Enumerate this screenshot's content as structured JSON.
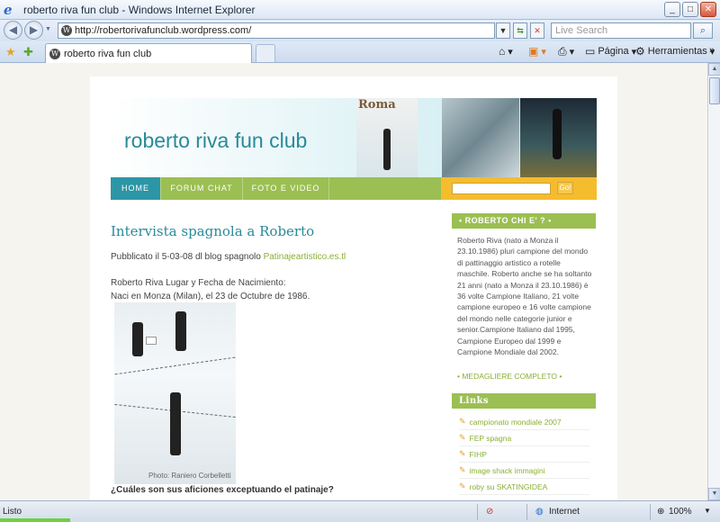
{
  "window": {
    "title": "roberto riva fun club - Windows Internet Explorer",
    "controls": [
      "_",
      "□",
      "✕"
    ]
  },
  "addressbar": {
    "url": "http://robertorivafunclub.wordpress.com/",
    "search_placeholder": "Live Search"
  },
  "tabs": [
    {
      "label": "roberto riva fun club"
    }
  ],
  "commandbar": {
    "page_label": "Página",
    "tools_label": "Herramientas"
  },
  "blog": {
    "title": "roberto riva fun club",
    "header_photo_text": "Roma",
    "nav": [
      "HOME",
      "FORUM CHAT",
      "FOTO E VIDEO"
    ],
    "search_button": "Go!"
  },
  "post": {
    "title": "Intervista spagnola a Roberto",
    "published_prefix": "Pubblicato il 5-03-08 dl blog spagnolo ",
    "published_link": "Patinajeartistico.es.tl",
    "line1": "Roberto Riva Lugar y Fecha de Nacimiento:",
    "line2": "Naci en Monza (Milan), el 23 de Octubre de 1986.",
    "photo_credit": "Photo: Raniero Corbelletti",
    "subheading": "¿Cuáles son sus aficiones exceptuando el patinaje?"
  },
  "sidebar": {
    "about_title": "• ROBERTO CHI E' ? •",
    "about_text": "Roberto Riva (nato a Monza il 23.10.1986) pluri campione del mondo di pattinaggio artistico a rotelle maschile. Roberto anche se ha soltanto 21 anni (nato a Monza il 23.10.1986) è 36 volte Campione Italiano, 21 volte campione europeo e 16 volte campione del mondo nelle categorie junior e senior.Campione Italiano dal 1995, Campione Europeo dal 1999 e Campione Mondiale dal 2002.",
    "about_more": "• MEDAGLIERE COMPLETO •",
    "links_title": "Links",
    "links": [
      "campionato mondiale 2007",
      "FEP spagna",
      "FIHP",
      "image shack immagini",
      "roby su SKATINGIDEA"
    ]
  },
  "statusbar": {
    "status": "Listo",
    "zone": "Internet",
    "zoom": "100%"
  },
  "colors": {
    "accent_teal": "#2a8a98",
    "nav_green": "#9bbf52",
    "search_orange": "#f5bc2e",
    "link_green": "#8ab035"
  }
}
